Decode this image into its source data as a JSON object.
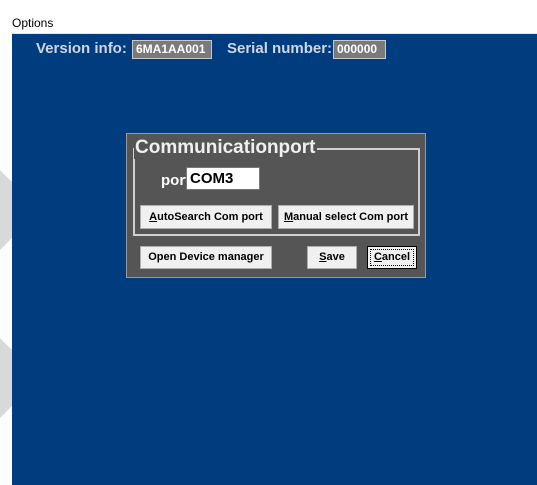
{
  "window": {
    "title": "Options"
  },
  "info": {
    "version_label": "Version info:",
    "version_value": "6MA1AA001",
    "serial_label": "Serial number:",
    "serial_value": "000000"
  },
  "comm": {
    "group_title": "Communicationport",
    "port_label": "port:",
    "port_value": "COM3",
    "autosearch_label": "AutoSearch Com port",
    "manual_label": "Manual select Com port"
  },
  "actions": {
    "device_manager_label": "Open Device manager",
    "save_label": "Save",
    "cancel_label": "Cancel"
  },
  "colors": {
    "client_bg": "#003c7e",
    "dialog_bg": "#555555"
  }
}
